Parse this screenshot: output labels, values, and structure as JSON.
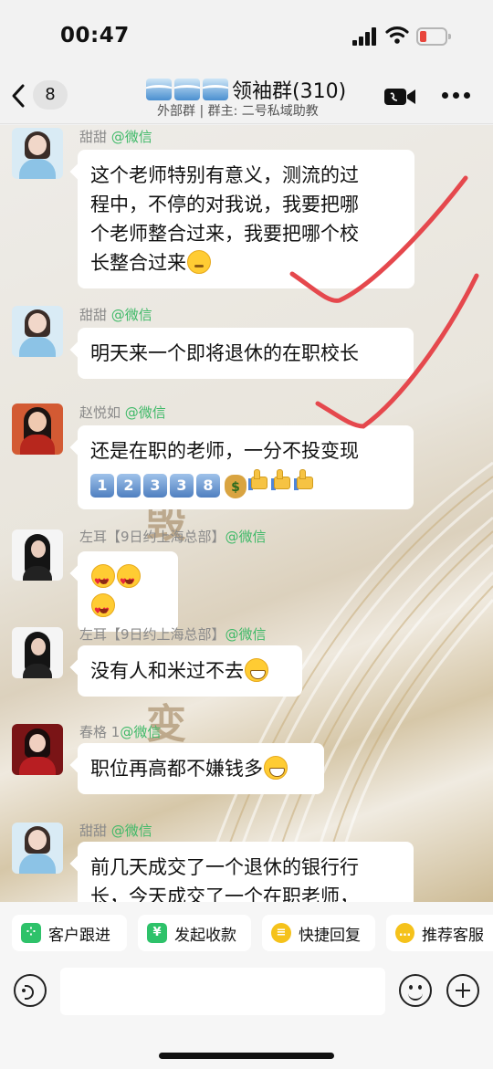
{
  "status_bar": {
    "time": "00:47"
  },
  "header": {
    "unread_count": "8",
    "group_title": "领袖群(310)",
    "subtitle": "外部群 | 群主: 二号私域助教"
  },
  "messages": [
    {
      "sender": "甜甜",
      "source": "@微信",
      "lines": [
        "这个老师特别有意义，测流的过",
        "程中，不停的对我说，我要把哪",
        "个老师整合过来，我要把哪个校",
        "长整合过来"
      ],
      "emoji": "thinking-face"
    },
    {
      "sender": "甜甜",
      "source": "@微信",
      "lines": [
        "明天来一个即将退休的在职校长"
      ]
    },
    {
      "sender": "赵悦如",
      "source": "@微信",
      "lines": [
        "还是在职的老师，一分不投变现"
      ],
      "keycaps": [
        "1",
        "2",
        "3",
        "3",
        "8"
      ],
      "extra_emoji": [
        "money-bag",
        "thumbs-up",
        "thumbs-up",
        "thumbs-up"
      ]
    },
    {
      "sender": "左耳【9日约上海总部】",
      "source": "@微信",
      "emoji_only": [
        "heart-eyes",
        "heart-eyes",
        "heart-eyes"
      ]
    },
    {
      "sender": "左耳【9日约上海总部】",
      "source": "@微信",
      "lines": [
        "没有人和米过不去"
      ],
      "emoji": "grinning-face"
    },
    {
      "sender": "春格 1",
      "source": "@微信",
      "lines": [
        "职位再高都不嫌钱多"
      ],
      "emoji": "grinning-face"
    },
    {
      "sender": "甜甜",
      "source": "@微信",
      "lines": [
        "前几天成交了一个退休的银行行",
        "长，今天成交了一个在职老师，"
      ]
    }
  ],
  "toolbar": {
    "chips": [
      "客户跟进",
      "发起收款",
      "快捷回复",
      "推荐客服"
    ]
  },
  "colors": {
    "accent_green": "#3fb968",
    "check_red": "#e5484d"
  }
}
